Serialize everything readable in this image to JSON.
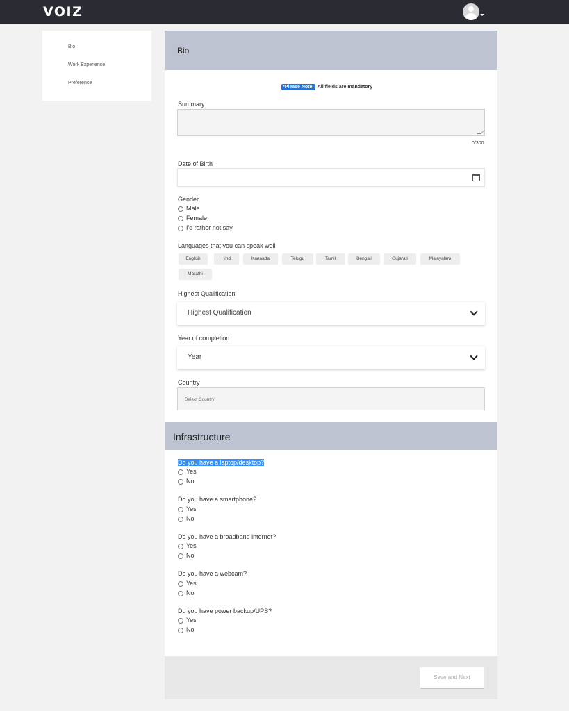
{
  "header": {
    "logo": "VOIZ"
  },
  "sidebar": {
    "items": [
      {
        "label": "Bio"
      },
      {
        "label": "Work Experience"
      },
      {
        "label": "Preference"
      }
    ]
  },
  "bio": {
    "title": "Bio",
    "note_badge": "*Please Note:",
    "note_text": "All fields are mandatory",
    "summary_label": "Summary",
    "summary_counter": "0/300",
    "dob_label": "Date of Birth",
    "gender_label": "Gender",
    "gender_options": [
      "Male",
      "Female",
      "I'd rather not say"
    ],
    "languages_label": "Languages that you can speak well",
    "languages": [
      "English",
      "Hindi",
      "Kannada",
      "Telugu",
      "Tamil",
      "Bengali",
      "Gujarati",
      "Malayalam",
      "Marathi"
    ],
    "qualification_label": "Highest Qualification",
    "qualification_value": "Highest Qualification",
    "year_label": "Year of completion",
    "year_value": "Year",
    "country_label": "Country",
    "country_placeholder": "Select Country"
  },
  "infrastructure": {
    "title": "Infrastructure",
    "questions": [
      {
        "label": "Do you have a laptop/desktop?",
        "options": [
          "Yes",
          "No"
        ]
      },
      {
        "label": "Do you have a smartphone?",
        "options": [
          "Yes",
          "No"
        ]
      },
      {
        "label": "Do you have a broadband internet?",
        "options": [
          "Yes",
          "No"
        ]
      },
      {
        "label": "Do you have a webcam?",
        "options": [
          "Yes",
          "No"
        ]
      },
      {
        "label": "Do you have power backup/UPS?",
        "options": [
          "Yes",
          "No"
        ]
      }
    ]
  },
  "footer": {
    "save_next_label": "Save and Next"
  },
  "colors": {
    "topbar": "#2b2b33",
    "section_header": "#bdc3d1",
    "accent": "#1a73e8"
  }
}
